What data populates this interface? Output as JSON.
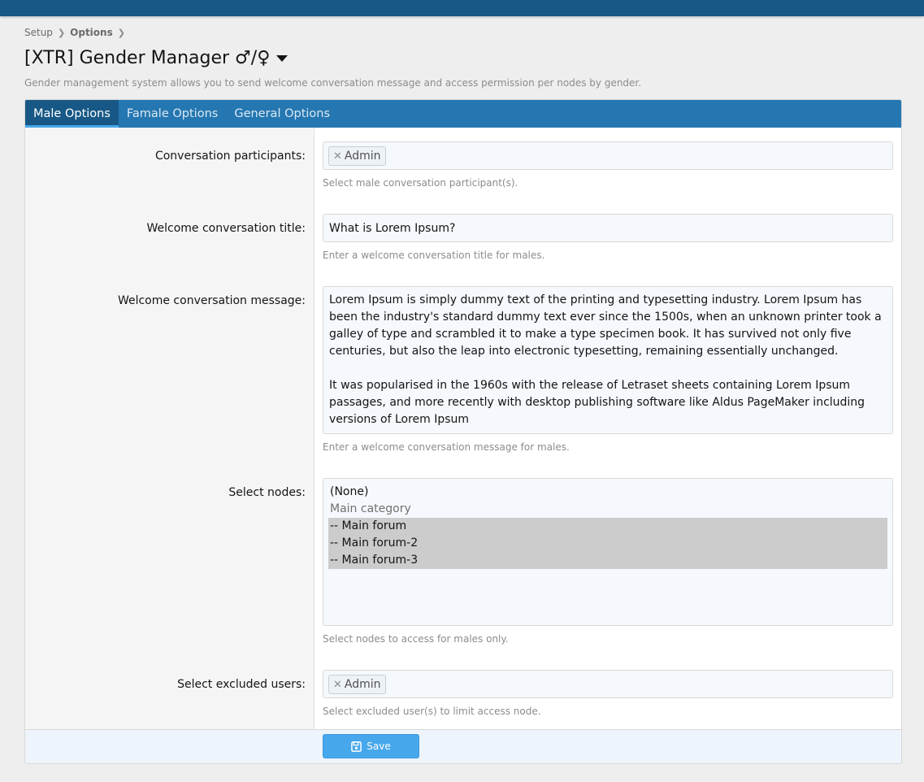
{
  "breadcrumb": {
    "items": [
      "Setup",
      "Options"
    ]
  },
  "page": {
    "title": "[XTR] Gender Manager ♂/♀",
    "description": "Gender management system allows you to send welcome conversation message and access permission per nodes by gender."
  },
  "tabs": [
    {
      "label": "Male Options",
      "active": true
    },
    {
      "label": "Famale Options",
      "active": false
    },
    {
      "label": "General Options",
      "active": false
    }
  ],
  "form": {
    "participants": {
      "label": "Conversation participants:",
      "token": "Admin",
      "hint": "Select male conversation participant(s)."
    },
    "welcome_title": {
      "label": "Welcome conversation title:",
      "value": "What is Lorem Ipsum?",
      "hint": "Enter a welcome conversation title for males."
    },
    "welcome_message": {
      "label": "Welcome conversation message:",
      "value": "Lorem Ipsum is simply dummy text of the printing and typesetting industry. Lorem Ipsum has been the industry's standard dummy text ever since the 1500s, when an unknown printer took a galley of type and scrambled it to make a type specimen book. It has survived not only five centuries, but also the leap into electronic typesetting, remaining essentially unchanged.\n\nIt was popularised in the 1960s with the release of Letraset sheets containing Lorem Ipsum passages, and more recently with desktop publishing software like Aldus PageMaker including versions of Lorem Ipsum",
      "hint": "Enter a welcome conversation message for males."
    },
    "nodes": {
      "label": "Select nodes:",
      "options": [
        "(None)",
        "Main category",
        "-- Main forum",
        "-- Main forum-2",
        "-- Main forum-3"
      ],
      "hint": "Select nodes to access for males only."
    },
    "excluded_users": {
      "label": "Select excluded users:",
      "token": "Admin",
      "hint": "Select excluded user(s) to limit access node."
    }
  },
  "footer": {
    "save_label": "Save"
  },
  "colors": {
    "header": "#185886",
    "tab_bar": "#2577b1",
    "button": "#47a7eb"
  }
}
